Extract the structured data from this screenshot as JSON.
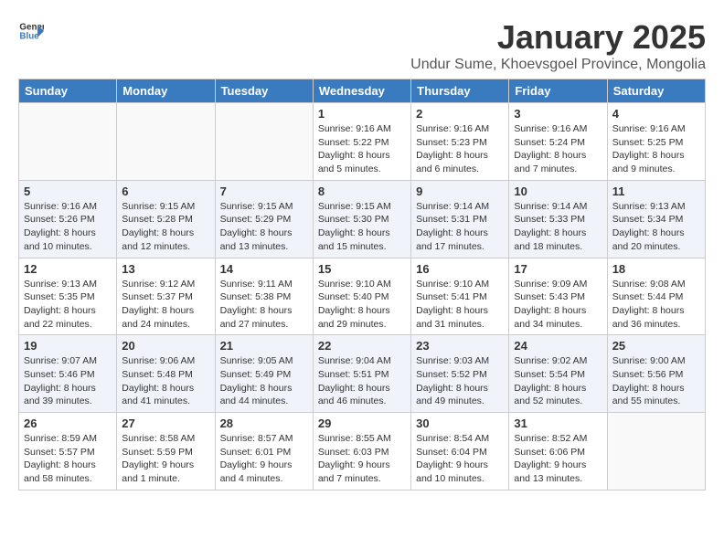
{
  "header": {
    "logo_line1": "General",
    "logo_line2": "Blue",
    "month": "January 2025",
    "location": "Undur Sume, Khoevsgoel Province, Mongolia"
  },
  "weekdays": [
    "Sunday",
    "Monday",
    "Tuesday",
    "Wednesday",
    "Thursday",
    "Friday",
    "Saturday"
  ],
  "weeks": [
    [
      {
        "day": "",
        "info": ""
      },
      {
        "day": "",
        "info": ""
      },
      {
        "day": "",
        "info": ""
      },
      {
        "day": "1",
        "info": "Sunrise: 9:16 AM\nSunset: 5:22 PM\nDaylight: 8 hours\nand 5 minutes."
      },
      {
        "day": "2",
        "info": "Sunrise: 9:16 AM\nSunset: 5:23 PM\nDaylight: 8 hours\nand 6 minutes."
      },
      {
        "day": "3",
        "info": "Sunrise: 9:16 AM\nSunset: 5:24 PM\nDaylight: 8 hours\nand 7 minutes."
      },
      {
        "day": "4",
        "info": "Sunrise: 9:16 AM\nSunset: 5:25 PM\nDaylight: 8 hours\nand 9 minutes."
      }
    ],
    [
      {
        "day": "5",
        "info": "Sunrise: 9:16 AM\nSunset: 5:26 PM\nDaylight: 8 hours\nand 10 minutes."
      },
      {
        "day": "6",
        "info": "Sunrise: 9:15 AM\nSunset: 5:28 PM\nDaylight: 8 hours\nand 12 minutes."
      },
      {
        "day": "7",
        "info": "Sunrise: 9:15 AM\nSunset: 5:29 PM\nDaylight: 8 hours\nand 13 minutes."
      },
      {
        "day": "8",
        "info": "Sunrise: 9:15 AM\nSunset: 5:30 PM\nDaylight: 8 hours\nand 15 minutes."
      },
      {
        "day": "9",
        "info": "Sunrise: 9:14 AM\nSunset: 5:31 PM\nDaylight: 8 hours\nand 17 minutes."
      },
      {
        "day": "10",
        "info": "Sunrise: 9:14 AM\nSunset: 5:33 PM\nDaylight: 8 hours\nand 18 minutes."
      },
      {
        "day": "11",
        "info": "Sunrise: 9:13 AM\nSunset: 5:34 PM\nDaylight: 8 hours\nand 20 minutes."
      }
    ],
    [
      {
        "day": "12",
        "info": "Sunrise: 9:13 AM\nSunset: 5:35 PM\nDaylight: 8 hours\nand 22 minutes."
      },
      {
        "day": "13",
        "info": "Sunrise: 9:12 AM\nSunset: 5:37 PM\nDaylight: 8 hours\nand 24 minutes."
      },
      {
        "day": "14",
        "info": "Sunrise: 9:11 AM\nSunset: 5:38 PM\nDaylight: 8 hours\nand 27 minutes."
      },
      {
        "day": "15",
        "info": "Sunrise: 9:10 AM\nSunset: 5:40 PM\nDaylight: 8 hours\nand 29 minutes."
      },
      {
        "day": "16",
        "info": "Sunrise: 9:10 AM\nSunset: 5:41 PM\nDaylight: 8 hours\nand 31 minutes."
      },
      {
        "day": "17",
        "info": "Sunrise: 9:09 AM\nSunset: 5:43 PM\nDaylight: 8 hours\nand 34 minutes."
      },
      {
        "day": "18",
        "info": "Sunrise: 9:08 AM\nSunset: 5:44 PM\nDaylight: 8 hours\nand 36 minutes."
      }
    ],
    [
      {
        "day": "19",
        "info": "Sunrise: 9:07 AM\nSunset: 5:46 PM\nDaylight: 8 hours\nand 39 minutes."
      },
      {
        "day": "20",
        "info": "Sunrise: 9:06 AM\nSunset: 5:48 PM\nDaylight: 8 hours\nand 41 minutes."
      },
      {
        "day": "21",
        "info": "Sunrise: 9:05 AM\nSunset: 5:49 PM\nDaylight: 8 hours\nand 44 minutes."
      },
      {
        "day": "22",
        "info": "Sunrise: 9:04 AM\nSunset: 5:51 PM\nDaylight: 8 hours\nand 46 minutes."
      },
      {
        "day": "23",
        "info": "Sunrise: 9:03 AM\nSunset: 5:52 PM\nDaylight: 8 hours\nand 49 minutes."
      },
      {
        "day": "24",
        "info": "Sunrise: 9:02 AM\nSunset: 5:54 PM\nDaylight: 8 hours\nand 52 minutes."
      },
      {
        "day": "25",
        "info": "Sunrise: 9:00 AM\nSunset: 5:56 PM\nDaylight: 8 hours\nand 55 minutes."
      }
    ],
    [
      {
        "day": "26",
        "info": "Sunrise: 8:59 AM\nSunset: 5:57 PM\nDaylight: 8 hours\nand 58 minutes."
      },
      {
        "day": "27",
        "info": "Sunrise: 8:58 AM\nSunset: 5:59 PM\nDaylight: 9 hours\nand 1 minute."
      },
      {
        "day": "28",
        "info": "Sunrise: 8:57 AM\nSunset: 6:01 PM\nDaylight: 9 hours\nand 4 minutes."
      },
      {
        "day": "29",
        "info": "Sunrise: 8:55 AM\nSunset: 6:03 PM\nDaylight: 9 hours\nand 7 minutes."
      },
      {
        "day": "30",
        "info": "Sunrise: 8:54 AM\nSunset: 6:04 PM\nDaylight: 9 hours\nand 10 minutes."
      },
      {
        "day": "31",
        "info": "Sunrise: 8:52 AM\nSunset: 6:06 PM\nDaylight: 9 hours\nand 13 minutes."
      },
      {
        "day": "",
        "info": ""
      }
    ]
  ]
}
